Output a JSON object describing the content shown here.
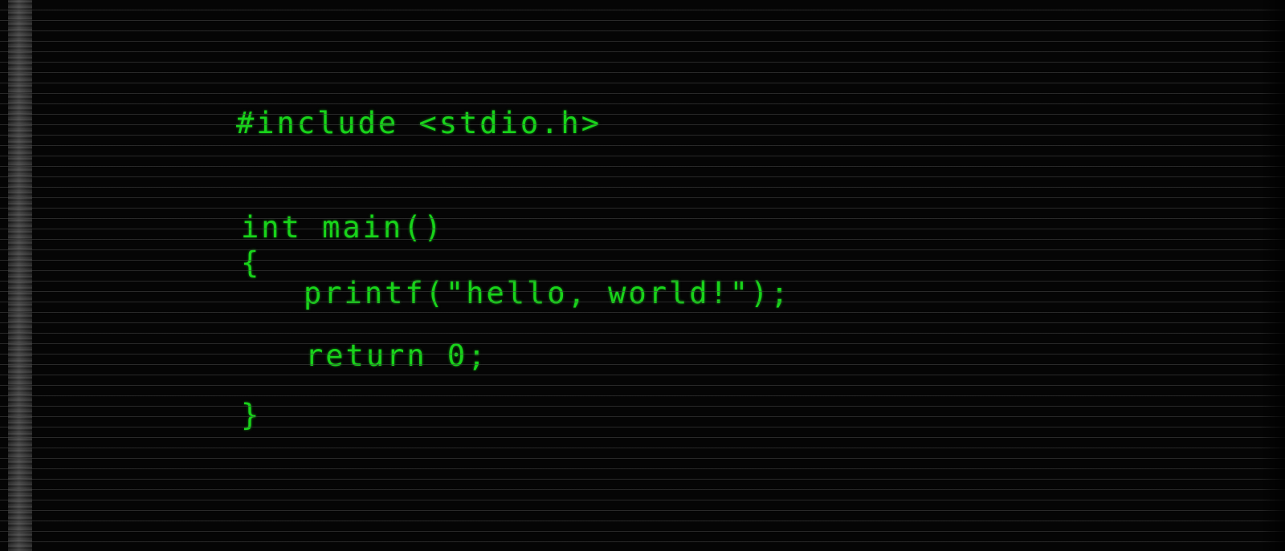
{
  "code_lines": [
    "#include <stdio.h>",
    "int main()",
    "{",
    "printf(\"hello, world!\");",
    "return 0;",
    "}"
  ],
  "colors": {
    "text": "#18d41a",
    "background": "#050505",
    "scanline": "#464646"
  }
}
